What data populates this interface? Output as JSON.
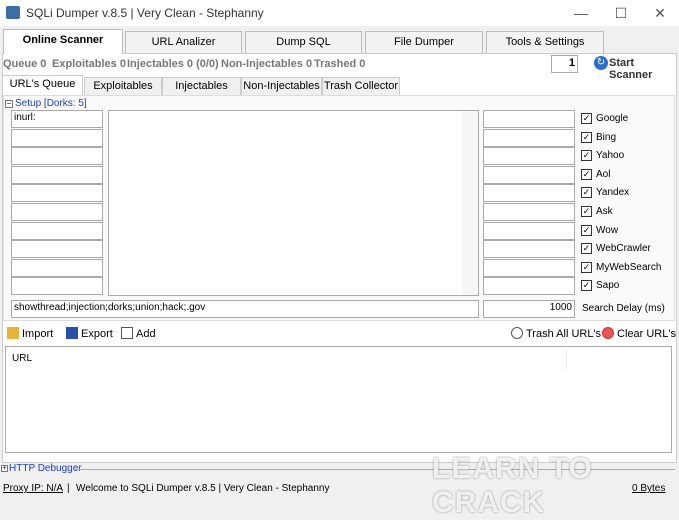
{
  "window": {
    "title": "SQLi Dumper v.8.5 | Very Clean - Stephanny",
    "minimize": "—",
    "maximize": "☐",
    "close": "✕"
  },
  "main_tabs": [
    {
      "label": "Online Scanner",
      "active": true
    },
    {
      "label": "URL Analizer"
    },
    {
      "label": "Dump SQL"
    },
    {
      "label": "File Dumper"
    },
    {
      "label": "Tools & Settings"
    }
  ],
  "stats": {
    "queue": "Queue 0",
    "exploitables": "Exploitables 0",
    "injectables": "Injectables 0 (0/0)",
    "non_injectables": "Non-Injectables 0",
    "trashed": "Trashed 0"
  },
  "threads": "1",
  "start_scanner": "Start Scanner",
  "sub_tabs": [
    {
      "label": "URL's Queue",
      "active": true
    },
    {
      "label": "Exploitables"
    },
    {
      "label": "Injectables"
    },
    {
      "label": "Non-Injectables"
    },
    {
      "label": "Trash Collector"
    }
  ],
  "setup": {
    "label": "Setup [Dorks: 5]",
    "left_fields": [
      "inurl:",
      "",
      "",
      "",
      "",
      "",
      "",
      "",
      "",
      ""
    ],
    "right_fields": [
      "",
      "",
      "",
      "",
      "",
      "",
      "",
      "",
      "",
      ""
    ],
    "engines": [
      {
        "label": "Google",
        "checked": true
      },
      {
        "label": "Bing",
        "checked": true
      },
      {
        "label": "Yahoo",
        "checked": true
      },
      {
        "label": "Aol",
        "checked": true
      },
      {
        "label": "Yandex",
        "checked": true
      },
      {
        "label": "Ask",
        "checked": true
      },
      {
        "label": "Wow",
        "checked": true
      },
      {
        "label": "WebCrawler",
        "checked": true
      },
      {
        "label": "MyWebSearch",
        "checked": true
      },
      {
        "label": "Sapo",
        "checked": true
      }
    ],
    "keywords": "showthread;injection;dorks;union;hack;.gov",
    "search_delay_value": "1000",
    "search_delay_label": "Search Delay (ms)"
  },
  "toolbar": {
    "import": "Import",
    "export": "Export",
    "add": "Add",
    "trash_all": "Trash All URL's",
    "clear": "Clear URL's"
  },
  "url_list": {
    "header": "URL"
  },
  "http_debugger": "HTTP Debugger",
  "statusbar": {
    "proxy": "Proxy IP: N/A",
    "message": "Welcome to SQLi Dumper v.8.5 | Very Clean - Stephanny",
    "bytes": "0 Bytes"
  },
  "watermark": "LEARN TO CRACK"
}
